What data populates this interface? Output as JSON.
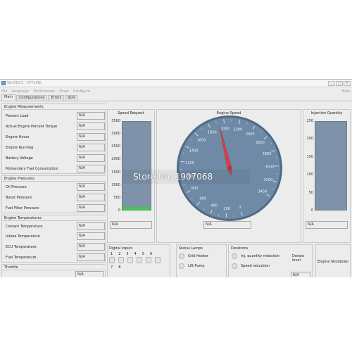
{
  "window": {
    "title": "WinEDC3 - OFFLINE"
  },
  "titlebar_controls": [
    "_",
    "□",
    "×"
  ],
  "menu": [
    "File",
    "Language",
    "Oscilloscope",
    "Show",
    "Configure"
  ],
  "menu_help": "Help",
  "tabs": [
    {
      "label": "Main",
      "active": true
    },
    {
      "label": "Configurations",
      "active": false
    },
    {
      "label": "Errors",
      "active": false
    },
    {
      "label": "SCR",
      "active": false
    }
  ],
  "engine_measurements": {
    "title": "Engine Measurements",
    "rows": [
      {
        "label": "Percent Load",
        "value": "N/A"
      },
      {
        "label": "Actual Engine Percent Torque",
        "value": "N/A"
      },
      {
        "label": "Engine Hours",
        "value": "N/A"
      },
      {
        "label": "Engine Running",
        "value": "N/A"
      },
      {
        "label": "Battery Voltage",
        "value": "N/A"
      },
      {
        "label": "Momentary Fuel Consumption",
        "value": "N/A"
      }
    ]
  },
  "engine_pressures": {
    "title": "Engine Pressures",
    "rows": [
      {
        "label": "Oil Pressure",
        "value": "N/A"
      },
      {
        "label": "Boost Pressure",
        "value": "N/A"
      },
      {
        "label": "Fuel Filter Pressure",
        "value": "N/A"
      }
    ]
  },
  "engine_temperatures": {
    "title": "Engine Temperatures",
    "rows": [
      {
        "label": "Coolant Temperature",
        "value": "N/A"
      },
      {
        "label": "Intake Temperature",
        "value": "N/A"
      },
      {
        "label": "ECU Temperature",
        "value": "N/A"
      },
      {
        "label": "Fuel Temperature",
        "value": "N/A"
      }
    ]
  },
  "throttle": {
    "title": "Throttle",
    "value": "N/A"
  },
  "speed_request": {
    "title": "Speed Request",
    "ticks": [
      "3500",
      "3000",
      "2500",
      "2000",
      "1500",
      "1000",
      "500",
      "0"
    ],
    "tick_values": [
      3500,
      3000,
      2500,
      2000,
      1500,
      1000,
      500,
      0
    ],
    "max": 3500,
    "level": 0.035,
    "readout": "N/A"
  },
  "engine_speed": {
    "title": "Engine Speed",
    "ticks": [
      "0",
      "200",
      "400",
      "600",
      "800",
      "1000",
      "1200",
      "1400",
      "1600",
      "1800",
      "2000",
      "2200",
      "2400",
      "2600",
      "2800",
      "3000",
      "3200",
      "3400"
    ],
    "max": 3400,
    "needle_value": 1930,
    "readout": "N/A"
  },
  "injection_quantity": {
    "title": "Injection Quantity",
    "ticks": [
      "250",
      "200",
      "150",
      "100",
      "50",
      "0"
    ],
    "tick_values": [
      250,
      200,
      150,
      100,
      50,
      0
    ],
    "max": 250,
    "level": 0.0,
    "readout": "N/A"
  },
  "digital_inputs": {
    "title": "Digital Inputs",
    "labels": [
      "1",
      "2",
      "3",
      "4",
      "5",
      "6",
      "7",
      "8"
    ]
  },
  "status_lamps": {
    "title": "Status Lamps",
    "items": [
      "Grid Heater",
      "Lift Pump"
    ]
  },
  "derations": {
    "title": "Derations",
    "items": [
      "Inj. quantity reduction",
      "Speed reduction"
    ],
    "decrate_label": "Derate level",
    "decrate_value": "N/A"
  },
  "engine_shutdown": {
    "label": "Engine Shutdown"
  },
  "watermark": "Store No: 1907068",
  "colors": {
    "gauge_face": "#6f8aa6",
    "gauge_ring": "#4f6b86",
    "bar_fill": "#7e93a9",
    "needle": "#d94040",
    "level_fill": "#45c84a"
  }
}
